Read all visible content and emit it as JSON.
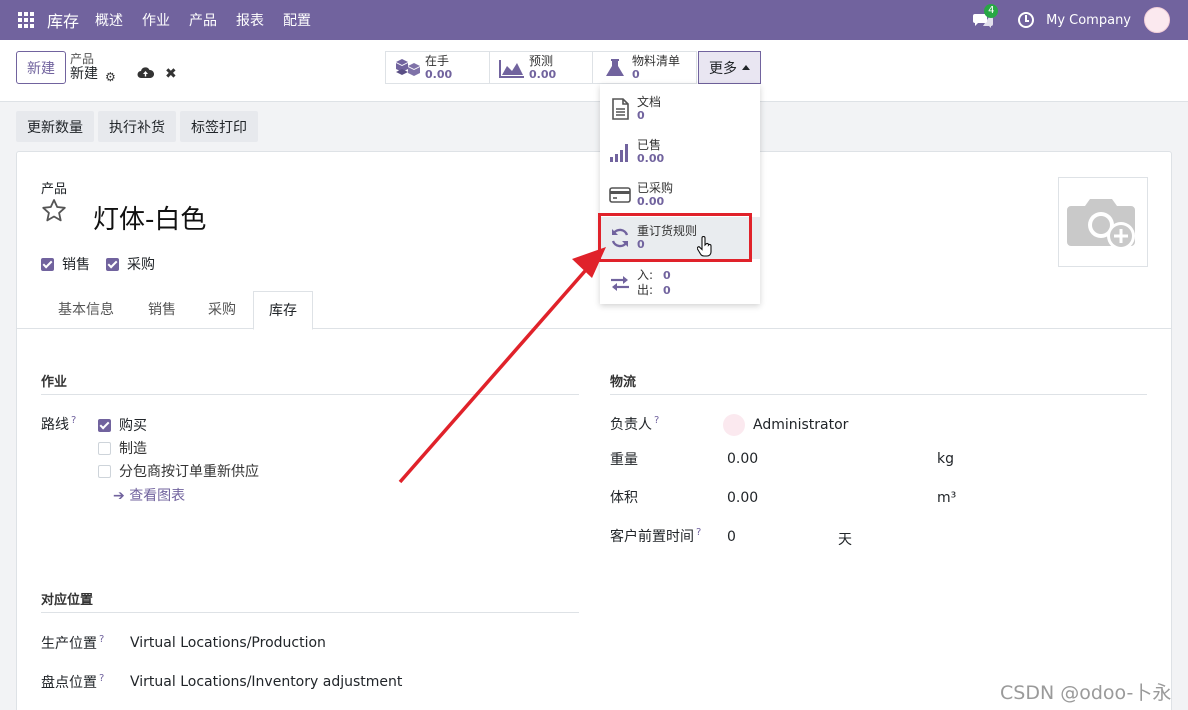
{
  "navbar": {
    "brand": "库存",
    "menu": [
      "概述",
      "作业",
      "产品",
      "报表",
      "配置"
    ],
    "chat_count": "4",
    "company": "My Company"
  },
  "control_panel": {
    "new_button": "新建",
    "breadcrumb_parent": "产品",
    "breadcrumb_current": "新建",
    "stats": [
      {
        "label": "在手",
        "value": "0.00",
        "icon": "cubes-icon"
      },
      {
        "label": "预测",
        "value": "0.00",
        "icon": "area-chart-icon"
      },
      {
        "label": "物料清单",
        "value": "0",
        "icon": "flask-icon"
      }
    ],
    "more_button": "更多"
  },
  "dropdown": {
    "items": [
      {
        "label": "文档",
        "value": "0",
        "icon": "document-icon"
      },
      {
        "label": "已售",
        "value": "0.00",
        "icon": "signal-icon"
      },
      {
        "label": "已采购",
        "value": "0.00",
        "icon": "credit-card-icon"
      },
      {
        "label": "重订货规则",
        "value": "0",
        "icon": "refresh-icon"
      }
    ],
    "in_label": "入:",
    "in_value": "0",
    "out_label": "出:",
    "out_value": "0"
  },
  "actions": [
    "更新数量",
    "执行补货",
    "标签打印"
  ],
  "product": {
    "label": "产品",
    "name": "灯体-白色",
    "sale_label": "销售",
    "purchase_label": "采购"
  },
  "tabs": [
    "基本信息",
    "销售",
    "采购",
    "库存"
  ],
  "operations": {
    "title": "作业",
    "routes_label": "路线",
    "routes": [
      {
        "label": "购买",
        "checked": true
      },
      {
        "label": "制造",
        "checked": false
      },
      {
        "label": "分包商按订单重新供应",
        "checked": false
      }
    ],
    "view_chart": "查看图表"
  },
  "logistics": {
    "title": "物流",
    "responsible_label": "负责人",
    "responsible_value": "Administrator",
    "weight_label": "重量",
    "weight_value": "0.00",
    "weight_unit": "kg",
    "volume_label": "体积",
    "volume_value": "0.00",
    "volume_unit": "m³",
    "lead_label": "客户前置时间",
    "lead_value": "0",
    "lead_unit": "天"
  },
  "locations": {
    "title": "对应位置",
    "production_label": "生产位置",
    "production_value": "Virtual Locations/Production",
    "inventory_label": "盘点位置",
    "inventory_value": "Virtual Locations/Inventory adjustment"
  },
  "help_mark": "?",
  "watermark": "CSDN @odoo-卜永",
  "colors": {
    "brand": "#71639e",
    "annotation": "#e0222a"
  }
}
